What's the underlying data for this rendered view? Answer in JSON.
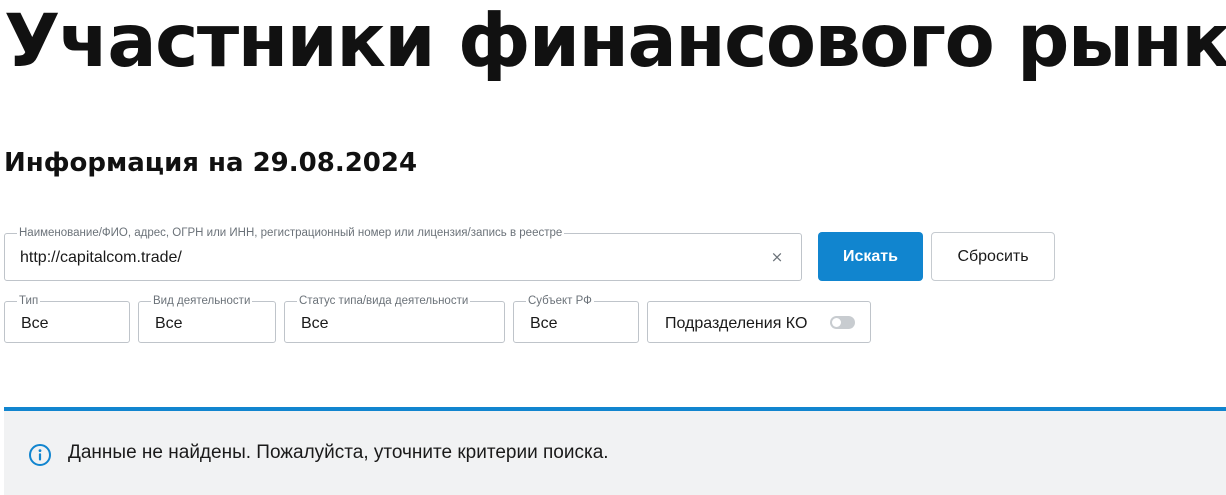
{
  "page": {
    "title": "Участники финансового рынка",
    "info_date": "Информация на 29.08.2024"
  },
  "search": {
    "legend": "Наименование/ФИО, адрес, ОГРН или ИНН, регистрационный номер или лицензия/запись в реестре",
    "value": "http://capitalcom.trade/",
    "clear_icon": "×",
    "search_button": "Искать",
    "reset_button": "Сбросить"
  },
  "filters": [
    {
      "legend": "Тип",
      "value": "Все"
    },
    {
      "legend": "Вид деятельности",
      "value": "Все"
    },
    {
      "legend": "Статус типа/вида деятельности",
      "value": "Все"
    },
    {
      "legend": "Субъект РФ",
      "value": "Все"
    }
  ],
  "toggle": {
    "label": "Подразделения КО",
    "state": "off"
  },
  "notice": {
    "icon": "info-icon",
    "text": "Данные не найдены. Пожалуйста, уточните критерии поиска.",
    "accent_color": "#1185cf"
  },
  "colors": {
    "primary": "#1185cf",
    "notice_bg": "#f1f2f3",
    "border": "#bfc4ca"
  }
}
